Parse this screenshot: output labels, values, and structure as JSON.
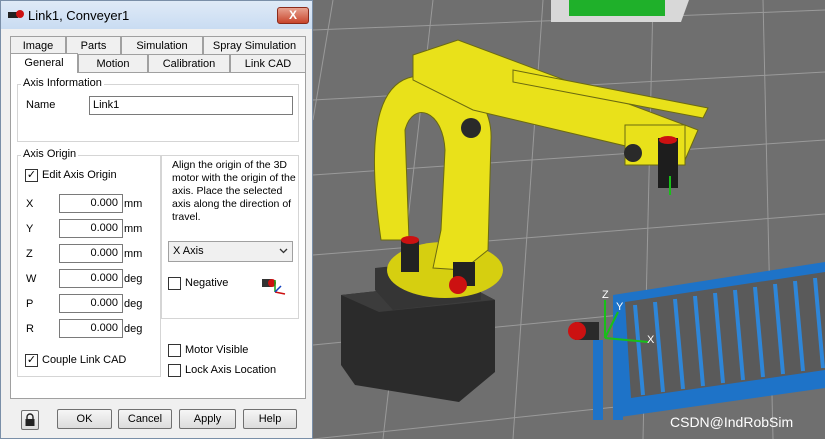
{
  "window": {
    "title": "Link1, Conveyer1",
    "close_glyph": "X"
  },
  "tabs_row1": [
    "Image",
    "Parts",
    "Simulation",
    "Spray Simulation"
  ],
  "tabs_row2": [
    "General",
    "Motion",
    "Calibration",
    "Link CAD"
  ],
  "active_tab": "General",
  "axis_information": {
    "group_label": "Axis Information",
    "name_label": "Name",
    "name_value": "Link1"
  },
  "axis_origin": {
    "group_label": "Axis Origin",
    "edit_label": "Edit Axis Origin",
    "edit_checked": true,
    "fields": [
      {
        "label": "X",
        "value": "0.000",
        "unit": "mm"
      },
      {
        "label": "Y",
        "value": "0.000",
        "unit": "mm"
      },
      {
        "label": "Z",
        "value": "0.000",
        "unit": "mm"
      },
      {
        "label": "W",
        "value": "0.000",
        "unit": "deg"
      },
      {
        "label": "P",
        "value": "0.000",
        "unit": "deg"
      },
      {
        "label": "R",
        "value": "0.000",
        "unit": "deg"
      }
    ],
    "couple_label": "Couple Link CAD",
    "couple_checked": true
  },
  "help_text": "Align the origin of the 3D motor with the origin of the axis.  Place the selected axis along the direction of travel.",
  "axis_select": {
    "value": "X Axis"
  },
  "negative": {
    "label": "Negative",
    "checked": false
  },
  "motor_visible": {
    "label": "Motor Visible",
    "checked": false
  },
  "lock_axis": {
    "label": "Lock Axis Location",
    "checked": false
  },
  "buttons": {
    "ok": "OK",
    "cancel": "Cancel",
    "apply": "Apply",
    "help": "Help"
  },
  "scene": {
    "watermark": "CSDN@IndRobSim",
    "axis_labels": {
      "z": "Z",
      "y": "Y",
      "x": "X"
    },
    "colors": {
      "robot": "#e9e11a",
      "floor": "#6f6f6f",
      "conveyor": "#1e73c8",
      "base": "#2b2b2b",
      "accent_red": "#cc1111",
      "green_block": "#1fb02a"
    }
  },
  "icons": {
    "lock": "lock-icon",
    "app": "link-icon",
    "axis": "axis-triad-icon"
  }
}
